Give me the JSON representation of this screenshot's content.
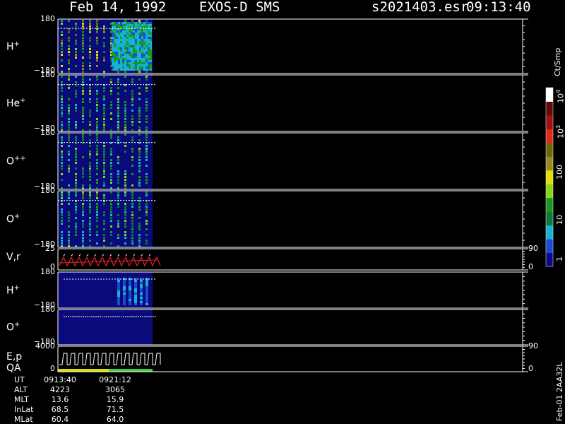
{
  "header": {
    "date": "Feb 14, 1992",
    "mission": "EXOS-D SMS",
    "file": "s2021403.esr",
    "time": "09:13:40"
  },
  "panels": [
    {
      "label_main": "H",
      "label_sup": "+",
      "y_top": "180",
      "y_bottom": "−180"
    },
    {
      "label_main": "He",
      "label_sup": "+",
      "y_top": "180",
      "y_bottom": "−180"
    },
    {
      "label_main": "O",
      "label_sup": "++",
      "y_top": "180",
      "y_bottom": "−180"
    },
    {
      "label_main": "O",
      "label_sup": "+",
      "y_top": "180",
      "y_bottom": "−180"
    },
    {
      "label_main": "V,r",
      "label_sup": "",
      "y_top": "25",
      "y_bottom": "0",
      "right_top": "90",
      "right_bottom": "0"
    },
    {
      "label_main": "H",
      "label_sup": "+",
      "y_top": "180",
      "y_bottom": "−180"
    },
    {
      "label_main": "O",
      "label_sup": "+",
      "y_top": "180",
      "y_bottom": "−180"
    },
    {
      "label_main": "E,p",
      "label_sup": "",
      "label_second": "QA",
      "y_top": "4000",
      "y_bottom": "0",
      "right_top": "90",
      "right_bottom": "0"
    }
  ],
  "colorbar": {
    "title": "Ct/Smp",
    "tick_labels": [
      "1",
      "10",
      "100",
      "10",
      "10"
    ],
    "tick_sups": [
      "",
      "",
      "",
      "3",
      "4"
    ],
    "colors": [
      "#0a0a8a",
      "#1a4ad8",
      "#14b4d0",
      "#0a7a3a",
      "#1a9a1a",
      "#8ad41a",
      "#e0e000",
      "#9a8a1a",
      "#6a6a0a",
      "#e02a1a",
      "#a01010",
      "#600a0a",
      "#ffffff"
    ]
  },
  "footer": {
    "side_label": "Feb-01  2AA32L",
    "rows": [
      {
        "label": "UT",
        "v1": "0913:40",
        "v2": "0921:12"
      },
      {
        "label": "ALT",
        "v1": "4223",
        "v2": "3065"
      },
      {
        "label": "MLT",
        "v1": "13.6",
        "v2": "15.9"
      },
      {
        "label": "InLat",
        "v1": "68.5",
        "v2": "71.5"
      },
      {
        "label": "MLat",
        "v1": "60.4",
        "v2": "64.0"
      }
    ]
  },
  "chart_data": {
    "type": "heatmap",
    "data_fraction_of_time_axis": 0.2,
    "colorbar_log_decades": [
      1,
      10,
      100,
      1000,
      10000
    ]
  }
}
